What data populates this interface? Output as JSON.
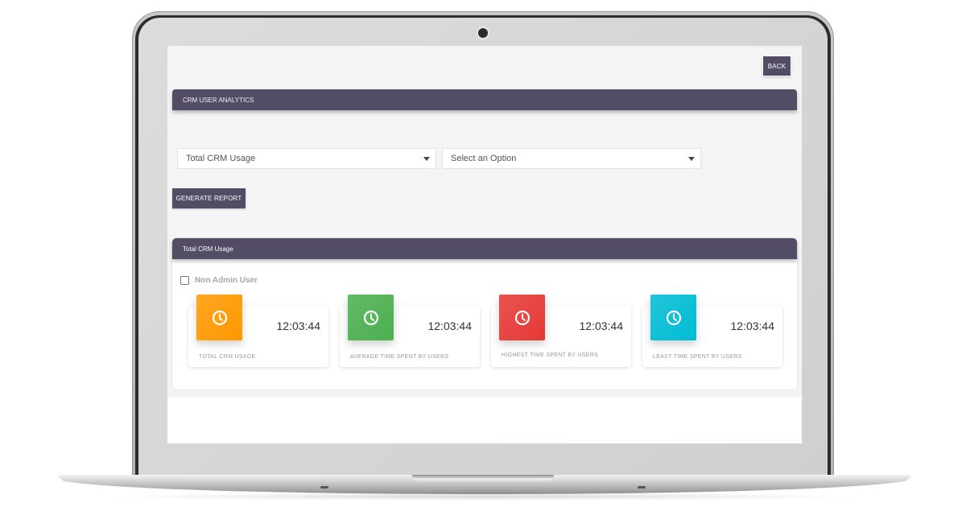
{
  "toolbar": {
    "back_label": "BACK"
  },
  "header": {
    "title": "CRM USER ANALYTICS"
  },
  "filters": {
    "report_type": {
      "selected": "Total CRM Usage"
    },
    "option": {
      "selected": "Select an Option"
    },
    "generate_label": "GENERATE REPORT"
  },
  "panel": {
    "title": "Total CRM Usage",
    "checkbox": {
      "label": "Non Admin User",
      "checked": false
    },
    "cards": [
      {
        "icon": "clock-icon",
        "value": "12:03:44",
        "label": "TOTAL CRM USAGE",
        "color": "#ff9800"
      },
      {
        "icon": "clock-icon",
        "value": "12:03:44",
        "label": "AVERAGE TIME SPENT BY USERS",
        "color": "#4caf50"
      },
      {
        "icon": "clock-icon",
        "value": "12:03:44",
        "label": "HIGHEST TIME SPENT BY USERS",
        "color": "#e53935"
      },
      {
        "icon": "clock-icon",
        "value": "12:03:44",
        "label": "LEAST TIME SPENT BY USERS",
        "color": "#00bcd4"
      }
    ]
  },
  "colors": {
    "primary": "#524c64",
    "orange": "#ff9800",
    "green": "#4caf50",
    "red": "#e53935",
    "cyan": "#00bcd4"
  }
}
